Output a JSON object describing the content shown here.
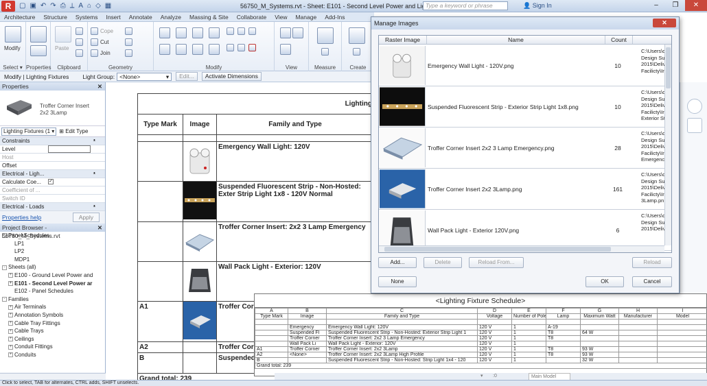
{
  "app": {
    "title": "56750_M_Systems.rvt - Sheet: E101 - Second Level Power and Lighting",
    "search_placeholder": "Type a keyword or phrase",
    "sign_in": "Sign In"
  },
  "ribbon_tabs": [
    "Architecture",
    "Structure",
    "Systems",
    "Insert",
    "Annotate",
    "Analyze",
    "Massing & Site",
    "Collaborate",
    "View",
    "Manage",
    "Add-Ins"
  ],
  "ribbon": {
    "modify": "Modify",
    "paste": "Paste",
    "cope": "Cope",
    "cut": "Cut",
    "join": "Join",
    "panels": [
      "Select ▾",
      "Properties",
      "Clipboard",
      "Geometry",
      "Modify",
      "View",
      "Measure",
      "Create"
    ]
  },
  "optbar": {
    "context": "Modify | Lighting Fixtures",
    "light_group_label": "Light Group:",
    "light_group_value": "<None>",
    "edit": "Edit...",
    "activate_dimensions": "Activate Dimensions"
  },
  "properties": {
    "header": "Properties",
    "type_name_line1": "Troffer Corner Insert",
    "type_name_line2": "2x2 3Lamp",
    "type_selector": "Lighting Fixtures (1 ▾",
    "edit_type": "Edit Type",
    "rows": [
      {
        "label": "Constraints",
        "kind": "cat"
      },
      {
        "label": "Level",
        "kind": "field"
      },
      {
        "label": "Host",
        "kind": "dis"
      },
      {
        "label": "Offset",
        "kind": "plain"
      },
      {
        "label": "Electrical - Ligh...",
        "kind": "cat"
      },
      {
        "label": "Calculate Coe...",
        "kind": "check"
      },
      {
        "label": "Coefficient of ...",
        "kind": "dis"
      },
      {
        "label": "Switch ID",
        "kind": "dis"
      },
      {
        "label": "Electrical - Loads",
        "kind": "cat"
      }
    ],
    "help": "Properties help",
    "apply": "Apply"
  },
  "project_browser": {
    "header": "Project Browser - 56750_M_Systems.rvt",
    "nodes": [
      {
        "t": "Panel Schedules",
        "lvl": 0,
        "ex": "-"
      },
      {
        "t": "LP1",
        "lvl": 2
      },
      {
        "t": "LP2",
        "lvl": 2
      },
      {
        "t": "MDP1",
        "lvl": 2
      },
      {
        "t": "Sheets (all)",
        "lvl": 0,
        "ex": "-"
      },
      {
        "t": "E100 - Ground Level Power and",
        "lvl": 1,
        "ex": "+"
      },
      {
        "t": "E101 - Second Level Power ar",
        "lvl": 1,
        "ex": "+",
        "b": true
      },
      {
        "t": "E102 - Panel Schedules",
        "lvl": 2
      },
      {
        "t": "Families",
        "lvl": 0,
        "ex": "-"
      },
      {
        "t": "Air Terminals",
        "lvl": 1,
        "ex": "+"
      },
      {
        "t": "Annotation Symbols",
        "lvl": 1,
        "ex": "+"
      },
      {
        "t": "Cable Tray Fittings",
        "lvl": 1,
        "ex": "+"
      },
      {
        "t": "Cable Trays",
        "lvl": 1,
        "ex": "+"
      },
      {
        "t": "Ceilings",
        "lvl": 1,
        "ex": "+"
      },
      {
        "t": "Conduit Fittings",
        "lvl": 1,
        "ex": "+"
      },
      {
        "t": "Conduits",
        "lvl": 1,
        "ex": "+"
      }
    ]
  },
  "sheet_schedule": {
    "title_fragment": "Lighting",
    "headers": [
      "Type Mark",
      "Image",
      "Family and Type"
    ],
    "rows": [
      {
        "mark": "",
        "family": "Emergency Wall Light: 120V"
      },
      {
        "mark": "",
        "family": "Suspended Fluorescent Strip - Non-Hosted: Exter Strip Light 1x8 - 120V Normal"
      },
      {
        "mark": "",
        "family": "Troffer Corner Insert: 2x2 3 Lamp Emergency"
      },
      {
        "mark": "",
        "family": "Wall Pack Light - Exterior: 120V"
      },
      {
        "mark": "A1",
        "family": "Troffer Corr"
      },
      {
        "mark": "A2",
        "family": "Troffer Corr"
      },
      {
        "mark": "B",
        "family": "Suspended Light 1x4 -"
      }
    ],
    "grand_total": "Grand total: 239"
  },
  "manage_images": {
    "title": "Manage Images",
    "columns": [
      "Raster Image",
      "Name",
      "Count"
    ],
    "rows": [
      {
        "name": "Emergency Wall Light - 120V.png",
        "count": "10",
        "path": "C:\\Users\\d Design Sui 2015\\Deliv Facilicty\\Ir"
      },
      {
        "name": "Suspended Fluorescent Strip - Exterior Strip Light 1x8.png",
        "count": "10",
        "path": "C:\\Users\\d Design Sui 2015\\Deliv Facilicty\\Ir Exterior St"
      },
      {
        "name": "Troffer Corner Insert  2x2 3 Lamp Emergency.png",
        "count": "28",
        "path": "C:\\Users\\d Design Sui 2015\\Deliv Facilicty\\Ir Emergency"
      },
      {
        "name": "Troffer Corner Insert 2x2 3Lamp.png",
        "count": "161",
        "path": "C:\\Users\\d Design Sui 2015\\Deliv Facilicty\\Ir 3Lamp.pn"
      },
      {
        "name": "Wall Pack Light - Exterior 120V.png",
        "count": "6",
        "path": "C:\\Users\\d Design Sui 2015\\Deliv"
      }
    ],
    "buttons": {
      "add": "Add...",
      "delete": "Delete",
      "reload_from": "Reload From...",
      "reload": "Reload",
      "none": "None",
      "ok": "OK",
      "cancel": "Cancel"
    }
  },
  "fixture_schedule": {
    "title": "<Lighting Fixture Schedule>",
    "letters": [
      "A",
      "B",
      "C",
      "D",
      "E",
      "F",
      "G",
      "H",
      "I"
    ],
    "headers": [
      "Type Mark",
      "Image",
      "Family and Type",
      "Voltage",
      "Number of Pole",
      "Lamp",
      "Maximum Watt",
      "Manufacturer",
      "Model"
    ],
    "rows": [
      [
        "",
        "",
        "",
        "",
        "",
        "",
        "",
        "",
        ""
      ],
      [
        "",
        "Emergency",
        "Emergency Wall Light: 120V",
        "120 V",
        "1",
        "A-19",
        "",
        "",
        ""
      ],
      [
        "",
        "Suspended Fl",
        "Suspended Fluorescent Strip - Non-Hosted: Exterior Strip Light 1",
        "120 V",
        "1",
        "T8",
        "64 W",
        "",
        ""
      ],
      [
        "",
        "Troffer Corner",
        "Troffer Corner Insert: 2x2 3 Lamp Emergency",
        "120 V",
        "1",
        "T8",
        "",
        "",
        ""
      ],
      [
        "",
        "Wall Pack Li",
        "Wall Pack Light - Exterior: 120V",
        "120 V",
        "1",
        "",
        "",
        "",
        ""
      ],
      [
        "A1",
        "Troffer Corner",
        "Troffer Corner Insert: 2x2 3Lamp",
        "120 V",
        "1",
        "T8",
        "93 W",
        "",
        ""
      ],
      [
        "A2",
        "<None>",
        "Troffer Corner Insert: 2x2 3Lamp High Profile",
        "120 V",
        "1",
        "T8",
        "93 W",
        "",
        ""
      ],
      [
        "B",
        "",
        "Suspended Fluorescent Strip - Non-Hosted: Strip Light 1x4 - 120",
        "120 V",
        "1",
        "",
        "32 W",
        "",
        ""
      ]
    ],
    "grand_total": "Grand total: 239"
  },
  "statusbar": {
    "hint": "Click to select, TAB for alternates, CTRL adds, SHIFT unselects.",
    "model": "Main Model",
    "zero": ":0"
  }
}
